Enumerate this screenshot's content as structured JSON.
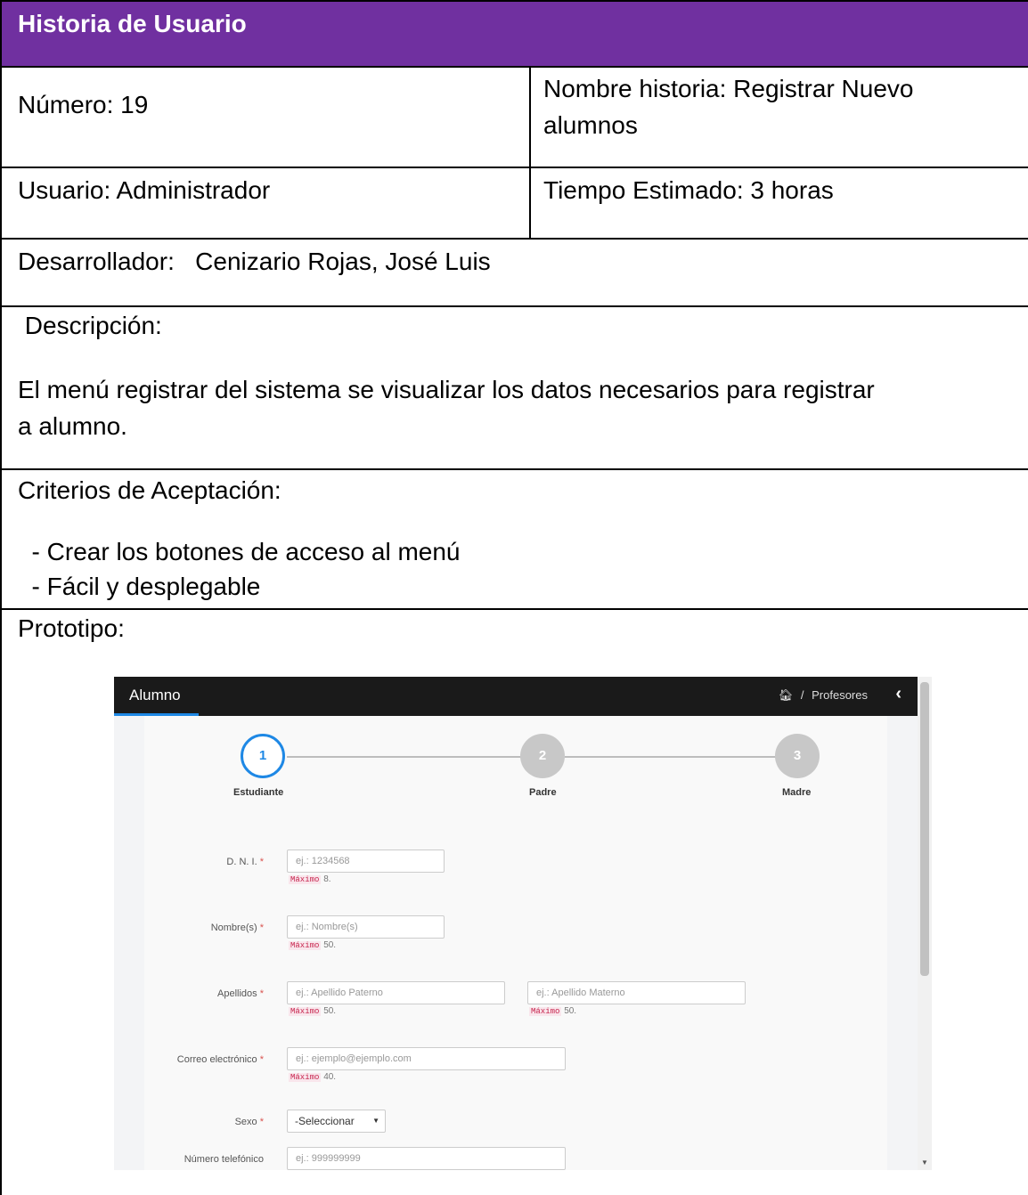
{
  "story": {
    "header": "Historia de Usuario",
    "numero": "Número: 19",
    "nombre_linea1": "Nombre historia: Registrar Nuevo",
    "nombre_linea2": "alumnos",
    "usuario": "Usuario: Administrador",
    "tiempo": "Tiempo Estimado: 3 horas",
    "desarrollador": "Desarrollador:   Cenizario Rojas, José Luis",
    "descripcion_label": " Descripción:",
    "descripcion_linea1": "El menú registrar del sistema se visualizar los datos necesarios para registrar",
    "descripcion_linea2": "a alumno.",
    "criterios_label": "Criterios de Aceptación:",
    "criterio1": "  - Crear los botones de acceso al menú",
    "criterio2": "  - Fácil y desplegable",
    "prototipo_label": "Prototipo:",
    "header_color": "#7030a0"
  },
  "prototype": {
    "title": "Alumno",
    "breadcrumb_home_icon": "home-icon",
    "breadcrumb_sep": "/",
    "breadcrumb": "Profesores",
    "collapse_icon": "chevron-left-icon",
    "steps": [
      {
        "number": "1",
        "label": "Estudiante",
        "active": true
      },
      {
        "number": "2",
        "label": "Padre",
        "active": false
      },
      {
        "number": "3",
        "label": "Madre",
        "active": false
      }
    ],
    "fields": {
      "dni": {
        "label": "D. N. I.",
        "placeholder": "ej.: 1234568",
        "hint_code": "Máximo",
        "hint_value": "8."
      },
      "nombres": {
        "label": "Nombre(s)",
        "placeholder": "ej.: Nombre(s)",
        "hint_code": "Máximo",
        "hint_value": "50."
      },
      "apellidos": {
        "label": "Apellidos",
        "placeholder_paterno": "ej.: Apellido Paterno",
        "placeholder_materno": "ej.: Apellido Materno",
        "hint_code": "Máximo",
        "hint_value": "50."
      },
      "correo": {
        "label": "Correo electrónico",
        "placeholder": "ej.: ejemplo@ejemplo.com",
        "hint_code": "Máximo",
        "hint_value": "40."
      },
      "sexo": {
        "label": "Sexo",
        "selected": "-Seleccionar"
      },
      "telefono": {
        "label": "Número telefónico",
        "placeholder": "ej.: 999999999"
      }
    },
    "required_mark": "*",
    "accent_color": "#1e88e5"
  }
}
